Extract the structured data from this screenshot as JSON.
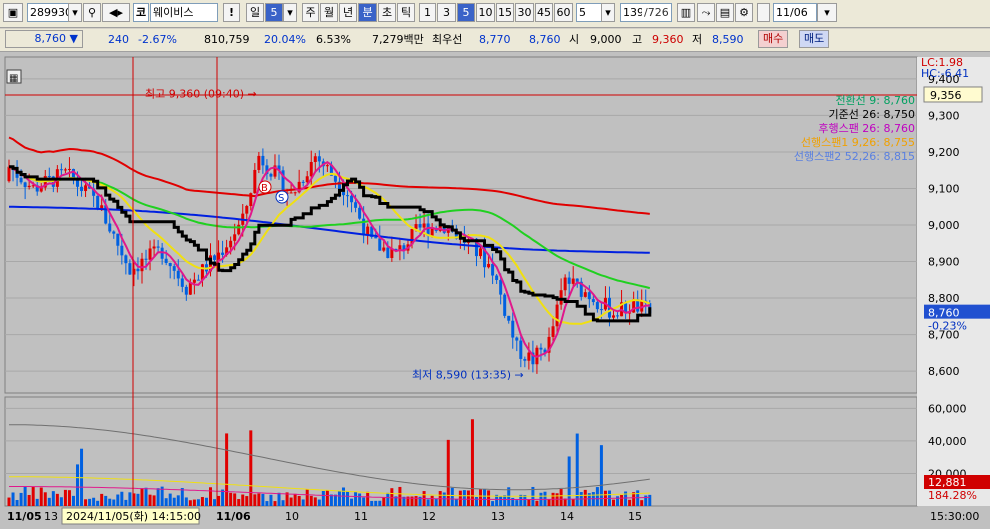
{
  "toolbar": {
    "code": "289930",
    "market_icon": "코",
    "name": "웨이비스",
    "alert": "!",
    "period_day": "일",
    "period_num": "5",
    "week": "주",
    "month": "월",
    "year": "년",
    "minute": "분",
    "second": "초",
    "tick": "틱",
    "intervals": [
      "1",
      "3",
      "5",
      "10",
      "15",
      "30",
      "45",
      "60"
    ],
    "custom_interval": "5",
    "page_count": "139",
    "page_total": "/726",
    "date": "11/06"
  },
  "quote": {
    "price": "8,760",
    "change_arrow": "▼",
    "change": "240",
    "change_pct": "-2.67%",
    "volume": "810,759",
    "volume_ratio": "20.04%",
    "turnover": "6.53%",
    "amount": "7,279백만",
    "best_bid_label": "최우선",
    "best_ask": "8,770",
    "best_bid": "8,760",
    "open_label": "시",
    "open": "9,000",
    "high_label": "고",
    "high": "9,360",
    "low_label": "저",
    "low": "8,590",
    "buy": "매수",
    "sell": "매도"
  },
  "colors": {
    "ma5": "#e0188c",
    "ma20": "#f0e010",
    "ma60": "#20d020",
    "ma120": "#0020e0",
    "ma240": "#e00000",
    "kijun": "#000000",
    "up_candle": "#e00000",
    "down_candle": "#0060e0"
  },
  "chart_data": {
    "type": "candlestick",
    "right_labels": {
      "lc": "LC:1.98",
      "hc": "HC:-6.41"
    },
    "legend": [
      {
        "name": "전환선 9: 8,760",
        "color": "#00a060"
      },
      {
        "name": "기준선 26: 8,750",
        "color": "#000000"
      },
      {
        "name": "후행스팬 26: 8,760",
        "color": "#c000c0"
      },
      {
        "name": "선행스팬1 9,26: 8,755",
        "color": "#f0a000"
      },
      {
        "name": "선행스팬2 52,26: 8,815",
        "color": "#5a80e0"
      }
    ],
    "price_ticks": [
      9400,
      9300,
      9200,
      9100,
      9000,
      8900,
      8800,
      8700,
      8600
    ],
    "price_tick_labels": [
      "9,400",
      "9,300",
      "9,200",
      "9,100",
      "9,000",
      "8,900",
      "8,800",
      "8,700",
      "8,600"
    ],
    "ylim": [
      8540,
      9460
    ],
    "crosshair_price": "9,356",
    "current_price": "8,760",
    "current_change": "-0.23%",
    "high_annotation": "최고 9,360 (09:40)",
    "low_annotation": "최저 8,590 (13:35)",
    "high_value": 9360,
    "low_value": 8590,
    "volume_ticks": [
      "60,000",
      "40,000",
      "20,000"
    ],
    "volume_tick_values": [
      60000,
      40000,
      20000
    ],
    "volume_ylim": [
      0,
      67000
    ],
    "current_volume": "12,881",
    "current_volume_ratio": "184.28%",
    "x_labels": [
      "11/05",
      "13",
      "11/06",
      "10",
      "11",
      "12",
      "13",
      "14",
      "15"
    ],
    "crosshair_time": "2024/11/05(화) 14:15:00",
    "right_time": "15:30:00",
    "markers": [
      "B",
      "S"
    ]
  }
}
